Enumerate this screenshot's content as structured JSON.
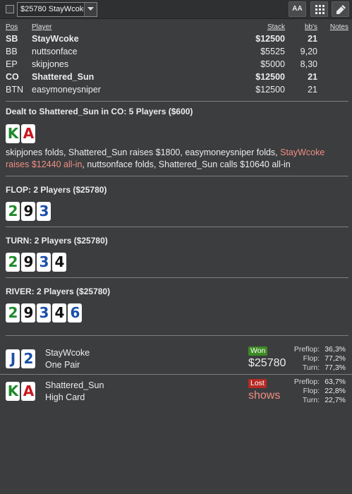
{
  "toolbar": {
    "hand_select": "$25780 StayWcoke",
    "font_button": "AA",
    "grid_button_icon": "grid-icon",
    "edit_button_icon": "pencil-icon"
  },
  "table": {
    "headers": {
      "pos": "Pos",
      "player": "Player",
      "stack": "Stack",
      "bbs": "bb's",
      "notes": "Notes"
    },
    "rows": [
      {
        "pos": "SB",
        "player": "StayWcoke",
        "stack": "$12500",
        "bbs": "21",
        "bold": true
      },
      {
        "pos": "BB",
        "player": "nuttsonface",
        "stack": "$5525",
        "bbs": "9,20",
        "bold": false
      },
      {
        "pos": "EP",
        "player": "skipjones",
        "stack": "$5000",
        "bbs": "8,30",
        "bold": false
      },
      {
        "pos": "CO",
        "player": "Shattered_Sun",
        "stack": "$12500",
        "bbs": "21",
        "bold": true
      },
      {
        "pos": "BTN",
        "player": "easymoneysniper",
        "stack": "$12500",
        "bbs": "21",
        "bold": false
      }
    ]
  },
  "preflop": {
    "title": "Dealt to Shattered_Sun in CO: 5 Players ($600)",
    "cards": [
      {
        "rank": "K",
        "color": "#1e8a2b"
      },
      {
        "rank": "A",
        "color": "#c8181e"
      }
    ],
    "action_part1": "skipjones folds, Shattered_Sun raises $1800, easymoneysniper folds, ",
    "action_highlight": "StayWcoke raises $12440 all-in",
    "action_part2": ", nuttsonface folds, Shattered_Sun calls $10640 all-in"
  },
  "flop": {
    "title": "FLOP: 2 Players ($25780)",
    "cards": [
      {
        "rank": "2",
        "color": "#1e8a2b"
      },
      {
        "rank": "9",
        "color": "#111111"
      },
      {
        "rank": "3",
        "color": "#1a4fa8"
      }
    ]
  },
  "turn": {
    "title": "TURN: 2 Players ($25780)",
    "cards": [
      {
        "rank": "2",
        "color": "#1e8a2b"
      },
      {
        "rank": "9",
        "color": "#111111"
      },
      {
        "rank": "3",
        "color": "#1a4fa8"
      },
      {
        "rank": "4",
        "color": "#111111"
      }
    ]
  },
  "river": {
    "title": "RIVER: 2 Players ($25780)",
    "cards": [
      {
        "rank": "2",
        "color": "#1e8a2b"
      },
      {
        "rank": "9",
        "color": "#111111"
      },
      {
        "rank": "3",
        "color": "#1a4fa8"
      },
      {
        "rank": "4",
        "color": "#111111"
      },
      {
        "rank": "6",
        "color": "#1a4fa8"
      }
    ]
  },
  "results": [
    {
      "player": "StayWcoke",
      "hand": "One Pair",
      "cards": [
        {
          "rank": "J",
          "color": "#1a4fa8"
        },
        {
          "rank": "2",
          "color": "#1a4fa8"
        }
      ],
      "status": "Won",
      "amount": "$25780",
      "equity": [
        {
          "label": "Preflop:",
          "value": "36,3%"
        },
        {
          "label": "Flop:",
          "value": "77,2%"
        },
        {
          "label": "Turn:",
          "value": "77,3%"
        }
      ]
    },
    {
      "player": "Shattered_Sun",
      "hand": "High Card",
      "cards": [
        {
          "rank": "K",
          "color": "#1e8a2b"
        },
        {
          "rank": "A",
          "color": "#c8181e"
        }
      ],
      "status": "Lost",
      "amount": "shows",
      "equity": [
        {
          "label": "Preflop:",
          "value": "63,7%"
        },
        {
          "label": "Flop:",
          "value": "22,8%"
        },
        {
          "label": "Turn:",
          "value": "22,7%"
        }
      ]
    }
  ]
}
